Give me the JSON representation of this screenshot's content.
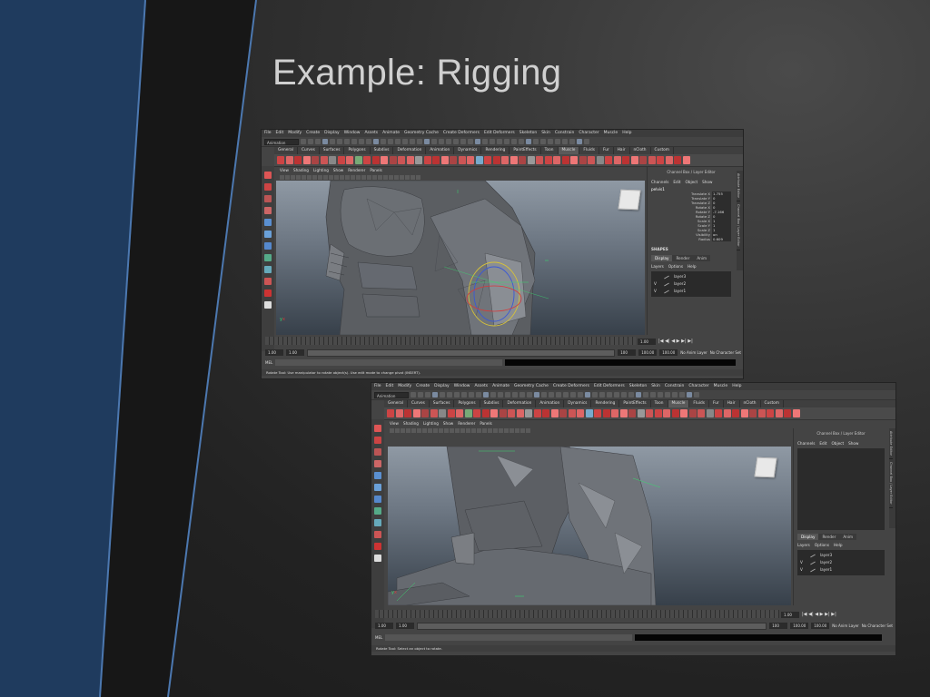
{
  "slide": {
    "title": "Example: Rigging",
    "colors": {
      "band_blue": "#1f3b5e",
      "band_border": "#4c78b0",
      "band_black": "#1a1a1a"
    }
  },
  "maya_menu": [
    "File",
    "Edit",
    "Modify",
    "Create",
    "Display",
    "Window",
    "Assets",
    "Animate",
    "Geometry Cache",
    "Create Deformers",
    "Edit Deformers",
    "Skeleton",
    "Skin",
    "Constrain",
    "Character",
    "Muscle",
    "Help"
  ],
  "maya_mode": "Animation",
  "shelf_tabs": [
    "General",
    "Curves",
    "Surfaces",
    "Polygons",
    "Subdivs",
    "Deformation",
    "Animation",
    "Dynamics",
    "Rendering",
    "PaintEffects",
    "Toon",
    "Muscle",
    "Fluids",
    "Fur",
    "Hair",
    "nCloth",
    "Custom"
  ],
  "shelf_active": "Muscle",
  "panel_menu": [
    "View",
    "Shading",
    "Lighting",
    "Show",
    "Renderer",
    "Panels"
  ],
  "channel_box": {
    "title": "Channel Box / Layer Editor",
    "menu": [
      "Channels",
      "Edit",
      "Object",
      "Show"
    ],
    "node": "pelvis1",
    "attributes": [
      {
        "name": "Translate X",
        "value": "1.755"
      },
      {
        "name": "Translate Y",
        "value": "0"
      },
      {
        "name": "Translate Z",
        "value": "0"
      },
      {
        "name": "Rotate X",
        "value": "0"
      },
      {
        "name": "Rotate Y",
        "value": "-7.166"
      },
      {
        "name": "Rotate Z",
        "value": "0"
      },
      {
        "name": "Scale X",
        "value": "1"
      },
      {
        "name": "Scale Y",
        "value": "1"
      },
      {
        "name": "Scale Z",
        "value": "1"
      },
      {
        "name": "Visibility",
        "value": "on"
      },
      {
        "name": "Radius",
        "value": "0.609"
      }
    ],
    "shapes_label": "SHAPES",
    "display_tabs": [
      "Display",
      "Render",
      "Anim"
    ],
    "layer_menu": [
      "Layers",
      "Options",
      "Help"
    ],
    "layers": [
      {
        "visible": "",
        "name": "layer3"
      },
      {
        "visible": "V",
        "name": "layer2"
      },
      {
        "visible": "V",
        "name": "layer1"
      }
    ]
  },
  "side_tabs": [
    "Attribute Editor",
    "Channel Box / Layer Editor"
  ],
  "timeline": {
    "current_frame": "1.00",
    "start": "1.00",
    "inner_start": "1.00",
    "range_start": "1",
    "range_end": "100",
    "inner_end": "100.00",
    "end": "100.00",
    "anim_layer": "No Anim Layer",
    "character_set": "No Character Set",
    "mel_label": "MEL"
  },
  "help_line_top": "Rotate Tool: Use manipulator to rotate object(s). Use edit mode to change pivot (INSERT).",
  "help_line_bottom": "Rotate Tool: Select an object to rotate."
}
